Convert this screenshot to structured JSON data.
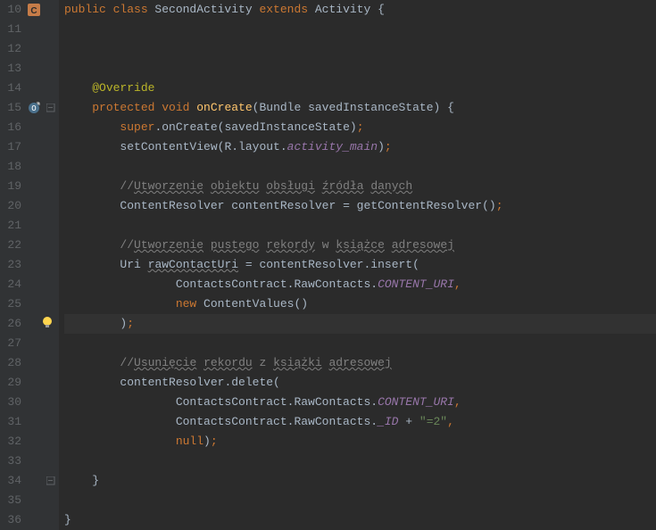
{
  "lines": {
    "start": 10,
    "end": 36,
    "current": 26
  },
  "code": {
    "l10": {
      "kw1": "public ",
      "kw2": "class ",
      "cls": "SecondActivity ",
      "kw3": "extends ",
      "sup": "Activity {"
    },
    "l14": {
      "ann": "@Override"
    },
    "l15": {
      "kw1": "protected ",
      "kw2": "void ",
      "fn": "onCreate",
      "rest": "(Bundle savedInstanceState) {"
    },
    "l16": {
      "kw": "super",
      "dot": ".onCreate(savedInstanceState)",
      "semi": ";"
    },
    "l17": {
      "txt1": "setContentView(R.layout.",
      "fld": "activity_main",
      "txt2": ")",
      "semi": ";"
    },
    "l19": {
      "pre": "//",
      "c1": "Utworzenie",
      "c2": "obiektu",
      "c3": "obsługi",
      "c4": "źródła",
      "c5": "danych"
    },
    "l20": {
      "txt": "ContentResolver contentResolver = getContentResolver()",
      "semi": ";"
    },
    "l22": {
      "pre": "//",
      "c1": "Utworzenie",
      "c2": "pustego",
      "c3": "rekordy",
      "sp": " w ",
      "c4": "książce",
      "c5": "adresowej"
    },
    "l23": {
      "txt1": "Uri ",
      "var": "rawContactUri",
      "txt2": " = contentResolver.insert("
    },
    "l24": {
      "txt": "ContactsContract.RawContacts.",
      "fld": "CONTENT_URI",
      "comma": ","
    },
    "l25": {
      "kw": "new ",
      "txt": "ContentValues()"
    },
    "l26": {
      "txt": ")",
      "semi": ";"
    },
    "l28": {
      "pre": "//",
      "c1": "Usunięcie",
      "c2": "rekordu",
      "sp": " z ",
      "c3": "książki",
      "c4": "adresowej"
    },
    "l29": {
      "txt": "contentResolver.delete("
    },
    "l30": {
      "txt": "ContactsContract.RawContacts.",
      "fld": "CONTENT_URI",
      "comma": ","
    },
    "l31": {
      "txt1": "ContactsContract.RawContacts.",
      "fld": "_ID",
      "txt2": " + ",
      "str": "\"=2\"",
      "comma": ","
    },
    "l32": {
      "kw": "null",
      "txt": ")",
      "semi": ";"
    },
    "l34": {
      "txt": "}"
    },
    "l36": {
      "txt": "}"
    }
  },
  "icons": {
    "class": "class-icon",
    "override": "override-icon",
    "bulb": "bulb-icon",
    "fold": "fold-icon"
  }
}
